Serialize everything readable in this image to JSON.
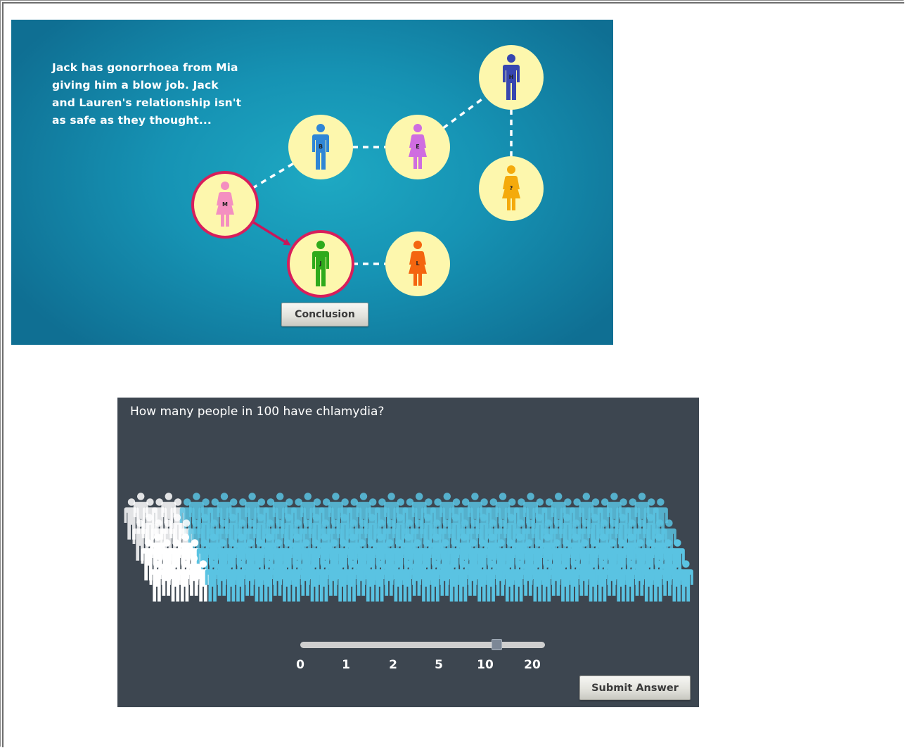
{
  "network": {
    "caption_lines": [
      "Jack has gonorrhoea from Mia",
      "giving him a blow job. Jack",
      "and Lauren's relationship isn't",
      "as safe as they thought..."
    ],
    "nodes": [
      {
        "id": "M",
        "label": "M",
        "gender": "female",
        "color": "#f48fc0",
        "highlighted": true
      },
      {
        "id": "B",
        "label": "B",
        "gender": "male",
        "color": "#2f86d6",
        "highlighted": false
      },
      {
        "id": "E",
        "label": "E",
        "gender": "female",
        "color": "#cf6de0",
        "highlighted": false
      },
      {
        "id": "H",
        "label": "H",
        "gender": "male",
        "color": "#3746b0",
        "highlighted": false
      },
      {
        "id": "Q",
        "label": "?",
        "gender": "female",
        "color": "#f4aa0c",
        "highlighted": false
      },
      {
        "id": "J",
        "label": "J",
        "gender": "male",
        "color": "#2faa1c",
        "highlighted": true
      },
      {
        "id": "L",
        "label": "L",
        "gender": "female",
        "color": "#f4650f",
        "highlighted": false
      }
    ],
    "conclusion_label": "Conclusion",
    "colors": {
      "node_fill": "#fdf7ad",
      "highlight_ring": "#d81e5b",
      "link": "#ffffff",
      "arrow": "#c8175a"
    }
  },
  "quiz": {
    "question": "How many people in 100 have chlamydia?",
    "slider_options": [
      "0",
      "1",
      "2",
      "5",
      "10",
      "20"
    ],
    "selected_value": "10",
    "submit_label": "Submit Answer",
    "colors": {
      "background": "#3d4650",
      "figure_blue": "#5ac3e2",
      "figure_white": "#ffffff"
    }
  }
}
